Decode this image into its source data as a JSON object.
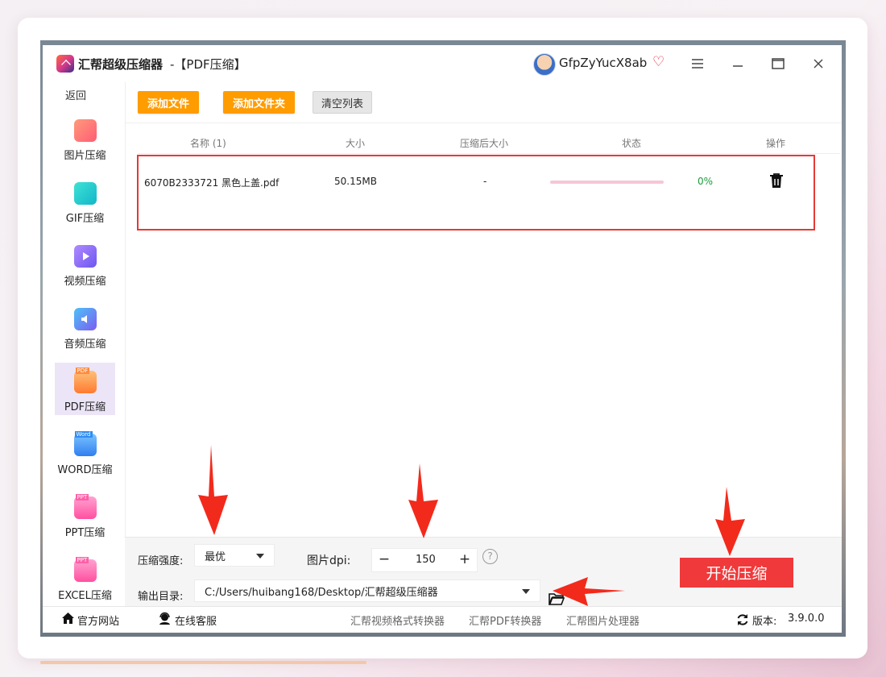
{
  "window": {
    "title": "汇帮超级压缩器",
    "subtitle": "-【PDF压缩】",
    "user_name": "GfpZyYucX8ab",
    "minimize": "—",
    "maximize": "▭",
    "close": "✕"
  },
  "sidebar": {
    "back_label": "返回",
    "items": [
      {
        "label": "图片压缩",
        "icon": "image-compress-icon",
        "color": "#ff7a6b"
      },
      {
        "label": "GIF压缩",
        "icon": "gif-compress-icon",
        "color": "#18c6c2"
      },
      {
        "label": "视频压缩",
        "icon": "video-compress-icon",
        "color": "#8a6cf6"
      },
      {
        "label": "音频压缩",
        "icon": "audio-compress-icon",
        "color": "#5a8cf6"
      },
      {
        "label": "PDF压缩",
        "icon": "pdf-compress-icon",
        "color": "#ff8a3d"
      },
      {
        "label": "WORD压缩",
        "icon": "word-compress-icon",
        "color": "#2f8df3"
      },
      {
        "label": "PPT压缩",
        "icon": "ppt-compress-icon",
        "color": "#ff5fa8"
      },
      {
        "label": "EXCEL压缩",
        "icon": "excel-compress-icon",
        "color": "#ff5fa8"
      }
    ]
  },
  "toolbar": {
    "add_file": "添加文件",
    "add_folder": "添加文件夹",
    "clear_list": "清空列表"
  },
  "table": {
    "columns": [
      "名称 (1)",
      "大小",
      "压缩后大小",
      "状态",
      "操作"
    ],
    "rows": [
      {
        "name": "6070B2333721 黑色上盖.pdf",
        "size": "50.15MB",
        "compressed_size": "-",
        "progress": 0,
        "percent": "0%"
      }
    ]
  },
  "settings": {
    "strength_label": "压缩强度:",
    "strength_value": "最优",
    "dpi_label": "图片dpi:",
    "dpi_value": "150",
    "dpi_minus": "−",
    "dpi_plus": "+",
    "help": "?",
    "output_label": "输出目录:",
    "output_path": "C:/Users/huibang168/Desktop/汇帮超级压缩器",
    "start_button": "开始压缩"
  },
  "footer": {
    "website": "官方网站",
    "support": "在线客服",
    "tools": [
      "汇帮视频格式转换器",
      "汇帮PDF转换器",
      "汇帮图片处理器"
    ],
    "version_label": "版本:",
    "version_value": "3.9.0.0"
  },
  "colors": {
    "accent_orange": "#ff9c00",
    "start_red": "#f0393b",
    "highlight_red": "#e53935",
    "annotation_arrow": "#f22a1c"
  }
}
